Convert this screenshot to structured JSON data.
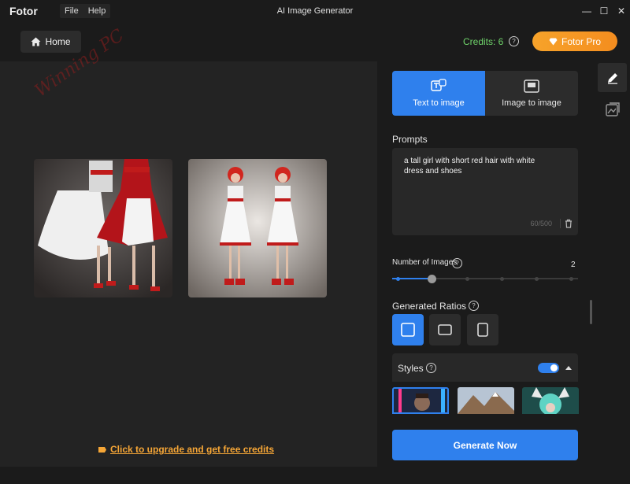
{
  "app": {
    "brand": "Fotor",
    "menu": [
      "File",
      "Help"
    ],
    "window_title": "AI Image Generator",
    "window_controls": [
      "—",
      "☐",
      "✕"
    ]
  },
  "topbar": {
    "home_label": "Home",
    "credits_label": "Credits: 6",
    "pro_label": "Fotor Pro"
  },
  "canvas": {
    "upgrade_link": "Click to upgrade and get free credits",
    "watermark": "Winning PC"
  },
  "panel": {
    "tabs": [
      {
        "label": "Text to image",
        "icon": "text-to-image-icon",
        "active": true
      },
      {
        "label": "Image to image",
        "icon": "image-to-image-icon",
        "active": false
      }
    ],
    "prompts_label": "Prompts",
    "prompt_text": "a tall girl with short red hair with white dress and shoes",
    "prompt_count": "60/500",
    "num_images_label": "Number of Images",
    "num_images_value": "2",
    "ratios_label": "Generated Ratios",
    "styles_label": "Styles",
    "generate_label": "Generate Now"
  },
  "colors": {
    "accent": "#2f80ed",
    "credits": "#6fd36a",
    "pro": "#f7a32a"
  }
}
